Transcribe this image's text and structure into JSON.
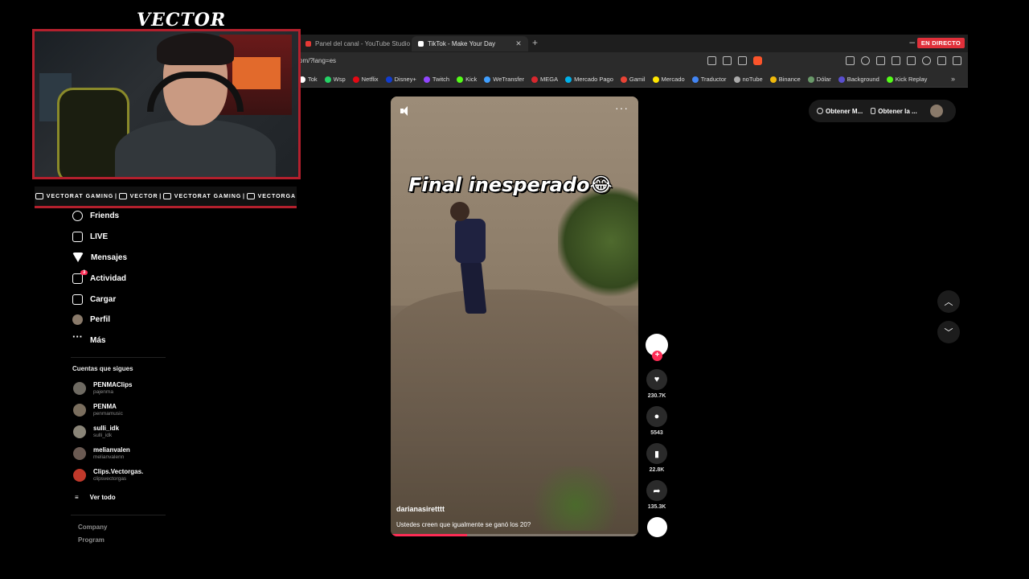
{
  "browser": {
    "tabs": [
      {
        "label": "Panel del canal - YouTube Studio",
        "active": false
      },
      {
        "label": "TikTok - Make Your Day",
        "active": true
      }
    ],
    "live_badge": "EN DIRECTO",
    "url": "om/?lang=es",
    "bookmarks": [
      {
        "label": "Tok",
        "color": "#ffffff"
      },
      {
        "label": "Wsp",
        "color": "#25d366"
      },
      {
        "label": "Netflix",
        "color": "#e50914"
      },
      {
        "label": "Disney+",
        "color": "#113ccf"
      },
      {
        "label": "Twitch",
        "color": "#9146ff"
      },
      {
        "label": "Kick",
        "color": "#53fc18"
      },
      {
        "label": "WeTransfer",
        "color": "#409fff"
      },
      {
        "label": "MEGA",
        "color": "#d9272e"
      },
      {
        "label": "Mercado Pago",
        "color": "#00b1ea"
      },
      {
        "label": "Gamil",
        "color": "#ea4335"
      },
      {
        "label": "Mercado",
        "color": "#ffe600"
      },
      {
        "label": "Traductor",
        "color": "#4285f4"
      },
      {
        "label": "noTube",
        "color": "#aaaaaa"
      },
      {
        "label": "Binance",
        "color": "#f0b90b"
      },
      {
        "label": "Dólar",
        "color": "#6a9a6a"
      },
      {
        "label": "Background",
        "color": "#5a4fcf"
      },
      {
        "label": "Kick Replay",
        "color": "#53fc18"
      }
    ]
  },
  "stream": {
    "title": "VECTOR",
    "socials": [
      {
        "icon": "youtube-icon",
        "label": "VECTORAT GAMING"
      },
      {
        "icon": "twitch-icon",
        "label": "VECTOR"
      },
      {
        "icon": "twitter-icon",
        "label": "VECTORAT GAMING"
      },
      {
        "icon": "instagram-icon",
        "label": "VECTORGA"
      }
    ]
  },
  "sidebar": {
    "nav": [
      {
        "label": "Friends",
        "icon": "friends-icon"
      },
      {
        "label": "LIVE",
        "icon": "live-icon"
      },
      {
        "label": "Mensajes",
        "icon": "messages-icon"
      },
      {
        "label": "Actividad",
        "icon": "activity-icon",
        "badge": "3"
      },
      {
        "label": "Cargar",
        "icon": "upload-icon"
      },
      {
        "label": "Perfil",
        "icon": "profile-avatar-icon"
      },
      {
        "label": "Más",
        "icon": "more-icon"
      }
    ],
    "following_title": "Cuentas que sigues",
    "following": [
      {
        "name": "PENMAClips",
        "handle": "pajenma"
      },
      {
        "name": "PENMA",
        "handle": "penmamusic"
      },
      {
        "name": "sulli_idk",
        "handle": "sulli_idk"
      },
      {
        "name": "melianvalen",
        "handle": "melianvalenn"
      },
      {
        "name": "Clips.Vectorgas.",
        "handle": "clipsvectorgas"
      }
    ],
    "see_all": "Ver todo",
    "footer": [
      "Company",
      "Program"
    ]
  },
  "video": {
    "overlay_text": "Final inesperado😂",
    "author": "darianasiretttt",
    "caption": "Ustedes creen que igualmente se ganó los 20?",
    "progress": 0.31
  },
  "actions": {
    "likes": "230.7K",
    "comments": "5543",
    "saves": "22.8K",
    "shares": "135.3K"
  },
  "top_right": {
    "items": [
      "Obtener M...",
      "Obtener la ..."
    ]
  }
}
